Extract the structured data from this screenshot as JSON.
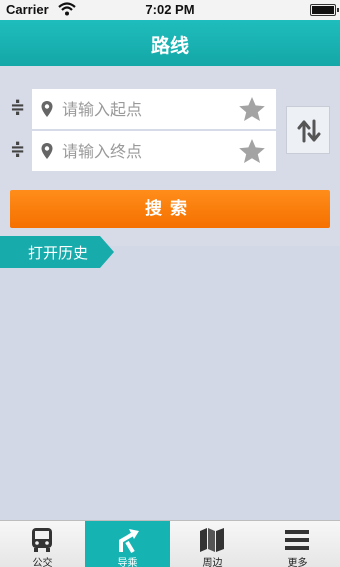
{
  "status_bar": {
    "carrier": "Carrier",
    "time": "7:02 PM"
  },
  "nav": {
    "title": "路线"
  },
  "form": {
    "start": {
      "placeholder": "请输入起点",
      "value": ""
    },
    "end": {
      "placeholder": "请输入终点",
      "value": ""
    },
    "search_label": "搜索"
  },
  "history": {
    "label": "打开历史"
  },
  "tabs": [
    {
      "label": "公交",
      "icon": "bus-icon",
      "active": false
    },
    {
      "label": "导乘",
      "icon": "route-arrow-icon",
      "active": true
    },
    {
      "label": "周边",
      "icon": "map-icon",
      "active": false
    },
    {
      "label": "更多",
      "icon": "menu-icon",
      "active": false
    }
  ],
  "colors": {
    "accent": "#16b3b3",
    "search_button": "#f57000",
    "background": "#d3d8e7"
  }
}
